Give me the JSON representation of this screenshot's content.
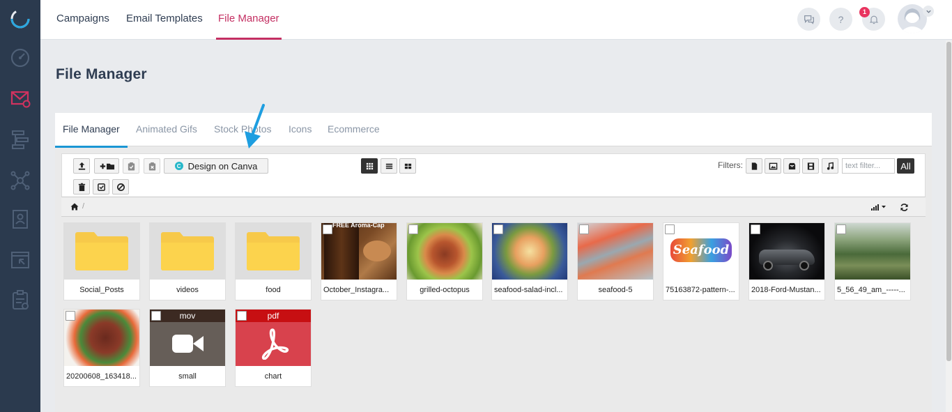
{
  "nav": {
    "tabs": [
      {
        "label": "Campaigns"
      },
      {
        "label": "Email Templates"
      },
      {
        "label": "File Manager"
      }
    ],
    "notification_count": "1",
    "help_label": "?"
  },
  "page": {
    "title": "File Manager"
  },
  "subtabs": [
    {
      "label": "File Manager"
    },
    {
      "label": "Animated Gifs"
    },
    {
      "label": "Stock Photos"
    },
    {
      "label": "Icons"
    },
    {
      "label": "Ecommerce"
    }
  ],
  "toolbar": {
    "canva_label": "Design on Canva",
    "filters_label": "Filters:",
    "text_filter_placeholder": "text filter...",
    "all_label": "All"
  },
  "files": [
    {
      "name": "Social_Posts",
      "kind": "folder"
    },
    {
      "name": "videos",
      "kind": "folder"
    },
    {
      "name": "food",
      "kind": "folder"
    },
    {
      "name": "October_Instagra...",
      "kind": "image",
      "overlay": "FREE Aroma-Cap"
    },
    {
      "name": "grilled-octopus",
      "kind": "image"
    },
    {
      "name": "seafood-salad-incl...",
      "kind": "image"
    },
    {
      "name": "seafood-5",
      "kind": "image"
    },
    {
      "name": "75163872-pattern-...",
      "kind": "image",
      "overlay": "Seafood"
    },
    {
      "name": "2018-Ford-Mustan...",
      "kind": "image"
    },
    {
      "name": "5_56_49_am_-----...",
      "kind": "image"
    },
    {
      "name": "20200608_163418...",
      "kind": "image"
    },
    {
      "name": "small",
      "kind": "video",
      "type_label": "mov"
    },
    {
      "name": "chart",
      "kind": "pdf",
      "type_label": "pdf"
    }
  ],
  "colors": {
    "sidebar": "#2b3a4e",
    "accent": "#c42f62",
    "tab_underline": "#1a96d4",
    "folder": "#fcd34d",
    "pdf": "#d8424d"
  }
}
